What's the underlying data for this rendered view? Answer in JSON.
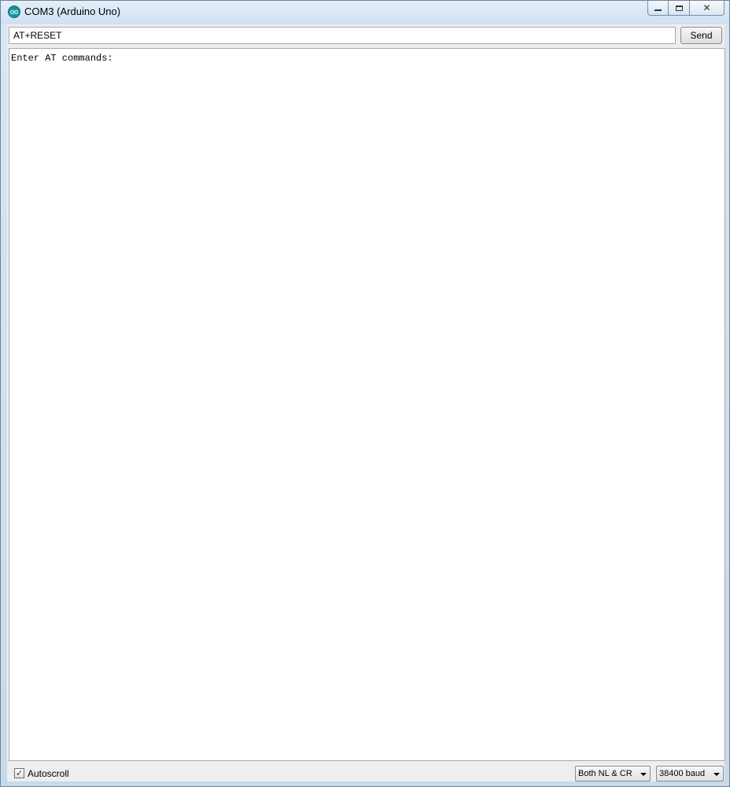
{
  "window": {
    "title": "COM3 (Arduino Uno)",
    "app_icon": "arduino-icon"
  },
  "caption_buttons": {
    "minimize_icon": "minimize-icon",
    "maximize_icon": "maximize-icon",
    "close_icon": "close-icon",
    "close_glyph": "✕"
  },
  "command_bar": {
    "input_value": "AT+RESET",
    "send_label": "Send"
  },
  "output": {
    "text": "Enter AT commands:"
  },
  "bottom_bar": {
    "autoscroll_label": "Autoscroll",
    "autoscroll_checked": true,
    "autoscroll_check_glyph": "✓",
    "line_ending": "Both NL & CR",
    "baud_rate": "38400 baud"
  },
  "colors": {
    "arduino_teal": "#17949c",
    "window_frame": "#c9dcef"
  }
}
